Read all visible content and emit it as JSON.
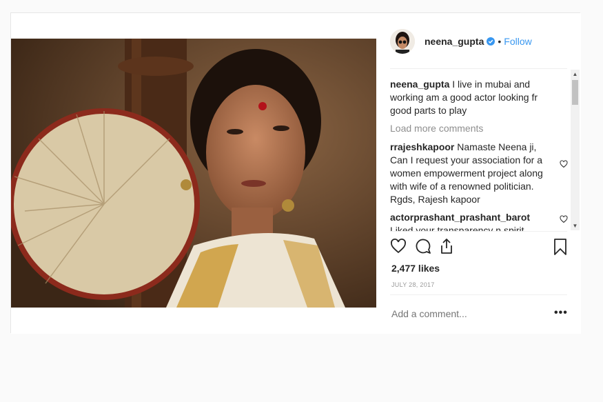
{
  "post": {
    "username": "neena_gupta",
    "follow_label": "Follow",
    "separator": "•",
    "caption": {
      "username": "neena_gupta",
      "text": "I live in mubai and working am a good actor looking fr good parts to play"
    },
    "load_more_label": "Load more comments",
    "comments": [
      {
        "username": "rrajeshkapoor",
        "text": "Namaste Neena ji, Can I request your association for a women empowerment project along with wife of a renowned politician. Rgds, Rajesh kapoor"
      },
      {
        "username": "actorprashant_prashant_barot",
        "text": "Liked your transparency n spirit ."
      }
    ],
    "likes": "2,477 likes",
    "date": "JULY 28, 2017",
    "add_comment_placeholder": "Add a comment...",
    "more_options": "•••"
  },
  "icons": {
    "verified": "verified-badge-icon",
    "like": "heart-icon",
    "comment": "comment-icon",
    "share": "share-icon",
    "save": "bookmark-icon",
    "comment_like": "heart-outline-icon"
  },
  "colors": {
    "follow": "#3897f0",
    "verified": "#3897f0",
    "muted": "#8e8e8e"
  }
}
